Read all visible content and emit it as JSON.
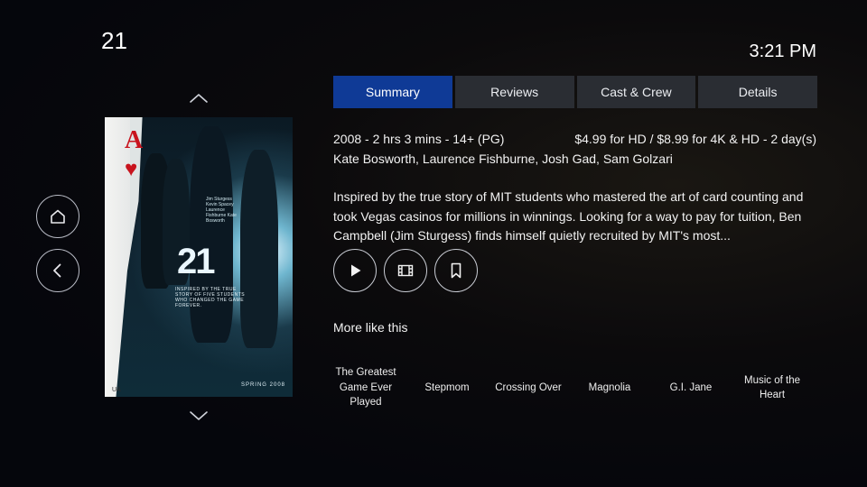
{
  "header": {
    "title": "21",
    "time": "3:21 PM"
  },
  "nav": {
    "home_icon": "home-icon",
    "back_icon": "back-icon"
  },
  "poster": {
    "ace_letter": "A",
    "movie_title": "21",
    "credits_text": "Jim Sturgess Kevin Spacey Laurence Fishburne Kate Bosworth",
    "tagline": "INSPIRED BY THE TRUE STORY OF FIVE STUDENTS WHO CHANGED THE GAME FOREVER.",
    "rating_mark": "UA",
    "release": "SPRING 2008"
  },
  "tabs": [
    {
      "label": "Summary",
      "active": true
    },
    {
      "label": "Reviews",
      "active": false
    },
    {
      "label": "Cast & Crew",
      "active": false
    },
    {
      "label": "Details",
      "active": false
    }
  ],
  "details": {
    "meta": "2008 - 2 hrs 3 mins - 14+ (PG)",
    "price": "$4.99 for HD / $8.99 for 4K & HD - 2 day(s)",
    "cast": "Kate Bosworth, Laurence Fishburne, Josh Gad, Sam Golzari",
    "description": "Inspired by the true story of MIT students who mastered the art of card counting and took Vegas casinos for millions in winnings. Looking for a way to pay for tuition, Ben Campbell (Jim Sturgess) finds himself quietly recruited by MIT's most..."
  },
  "actions": [
    {
      "name": "play-button",
      "icon": "play-icon"
    },
    {
      "name": "trailer-button",
      "icon": "film-icon"
    },
    {
      "name": "bookmark-button",
      "icon": "bookmark-icon"
    }
  ],
  "more_like_this": {
    "title": "More like this",
    "items": [
      "The Greatest Game Ever Played",
      "Stepmom",
      "Crossing Over",
      "Magnolia",
      "G.I. Jane",
      "Music of the Heart"
    ]
  },
  "colors": {
    "active_tab": "#0f3a96",
    "inactive_tab": "#2a2d33",
    "background": "#05060c"
  }
}
